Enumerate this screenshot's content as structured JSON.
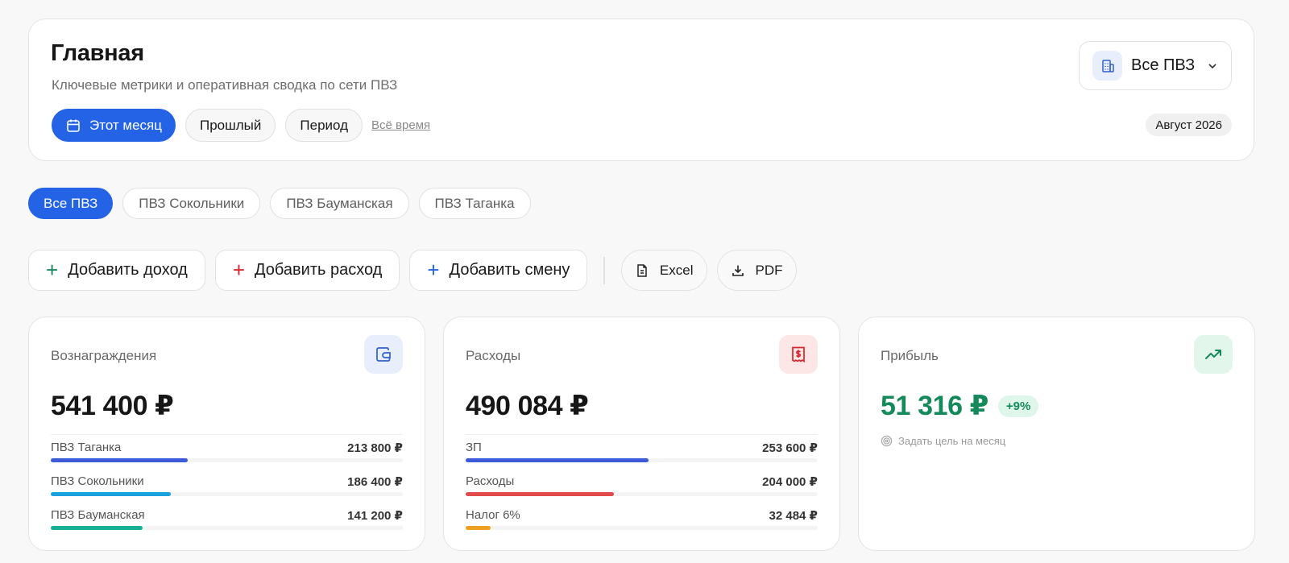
{
  "header": {
    "title": "Главная",
    "subtitle": "Ключевые метрики и оперативная сводка по сети ПВЗ",
    "period_buttons": [
      "Этот месяц",
      "Прошлый",
      "Период"
    ],
    "all_time_link": "Всё время",
    "pvz_select": {
      "icon": "building-icon",
      "value": "Все ПВЗ"
    },
    "month_badge": "Август 2026"
  },
  "pvz_tabs": [
    "Все ПВЗ",
    "ПВЗ Сокольники",
    "ПВЗ Бауманская",
    "ПВЗ Таганка"
  ],
  "actions": {
    "add_income": "Добавить доход",
    "add_expense": "Добавить расход",
    "add_shift": "Добавить смену",
    "excel": "Excel",
    "pdf": "PDF"
  },
  "cards": {
    "rewards": {
      "label": "Вознаграждения",
      "icon": "wallet-icon",
      "value": "541 400 ₽",
      "rows": [
        {
          "name": "ПВЗ Таганка",
          "amount": "213 800 ₽",
          "share": 0.39,
          "color": "#3b5bd9"
        },
        {
          "name": "ПВЗ Сокольники",
          "amount": "186 400 ₽",
          "share": 0.34,
          "color": "#1aa0dc"
        },
        {
          "name": "ПВЗ Бауманская",
          "amount": "141 200 ₽",
          "share": 0.26,
          "color": "#17b097"
        }
      ]
    },
    "expenses": {
      "label": "Расходы",
      "icon": "receipt-icon",
      "value": "490 084 ₽",
      "rows": [
        {
          "name": "ЗП",
          "amount": "253 600 ₽",
          "share": 0.52,
          "color": "#3b5bd9"
        },
        {
          "name": "Расходы",
          "amount": "204 000 ₽",
          "share": 0.42,
          "color": "#e24b4b"
        },
        {
          "name": "Налог 6%",
          "amount": "32 484 ₽",
          "share": 0.07,
          "color": "#f0a020"
        }
      ]
    },
    "profit": {
      "label": "Прибыль",
      "icon": "trending-up-icon",
      "value": "51 316 ₽",
      "growth": "+9%",
      "goal_link": "Задать цель на месяц"
    }
  },
  "colors": {
    "accent": "#2463e6",
    "profit": "#148a5b",
    "expense": "#d9262d"
  }
}
